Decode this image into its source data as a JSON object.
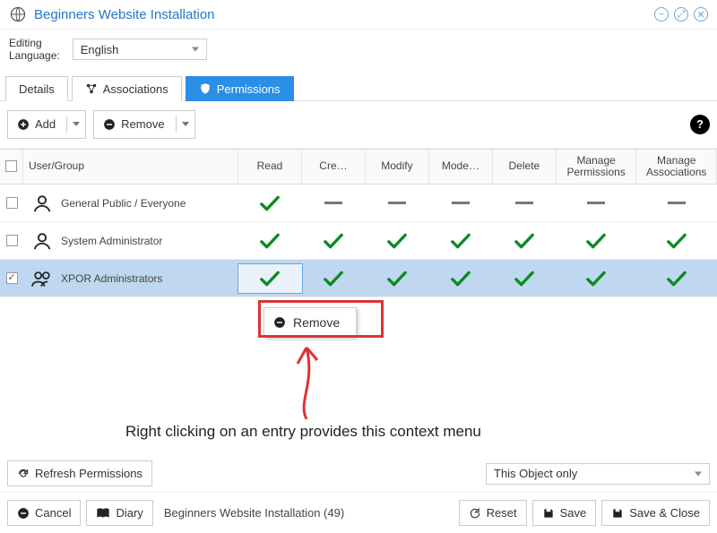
{
  "titlebar": {
    "title": "Beginners Website Installation"
  },
  "language": {
    "label": "Editing\nLanguage:",
    "value": "English"
  },
  "tabs": [
    {
      "id": "details",
      "label": "Details",
      "active": false
    },
    {
      "id": "associations",
      "label": "Associations",
      "active": false
    },
    {
      "id": "permissions",
      "label": "Permissions",
      "active": true
    }
  ],
  "toolbar": {
    "add": "Add",
    "remove": "Remove"
  },
  "columns": {
    "usergroup": "User/Group",
    "read": "Read",
    "create": "Cre…",
    "modify": "Modify",
    "moderate": "Mode…",
    "delete": "Delete",
    "manage_perm": "Manage Permissions",
    "manage_assoc": "Manage Associations"
  },
  "rows": [
    {
      "name": "General Public / Everyone",
      "type": "user",
      "selected": false,
      "perms": {
        "read": "check",
        "create": "dash",
        "modify": "dash",
        "moderate": "dash",
        "delete": "dash",
        "manage_perm": "dash",
        "manage_assoc": "dash"
      }
    },
    {
      "name": "System Administrator",
      "type": "user",
      "selected": false,
      "perms": {
        "read": "check",
        "create": "check",
        "modify": "check",
        "moderate": "check",
        "delete": "check",
        "manage_perm": "check",
        "manage_assoc": "check"
      }
    },
    {
      "name": "XPOR Administrators",
      "type": "group",
      "selected": true,
      "perms": {
        "read": "check",
        "create": "check",
        "modify": "check",
        "moderate": "check",
        "delete": "check",
        "manage_perm": "check",
        "manage_assoc": "check"
      }
    }
  ],
  "context_menu": {
    "remove": "Remove"
  },
  "annotation": {
    "text": "Right clicking on an entry provides this context menu"
  },
  "scope": {
    "refresh": "Refresh Permissions",
    "value": "This Object only"
  },
  "footer": {
    "cancel": "Cancel",
    "diary": "Diary",
    "object_name": "Beginners Website Installation (49)",
    "reset": "Reset",
    "save": "Save",
    "save_close": "Save & Close"
  }
}
